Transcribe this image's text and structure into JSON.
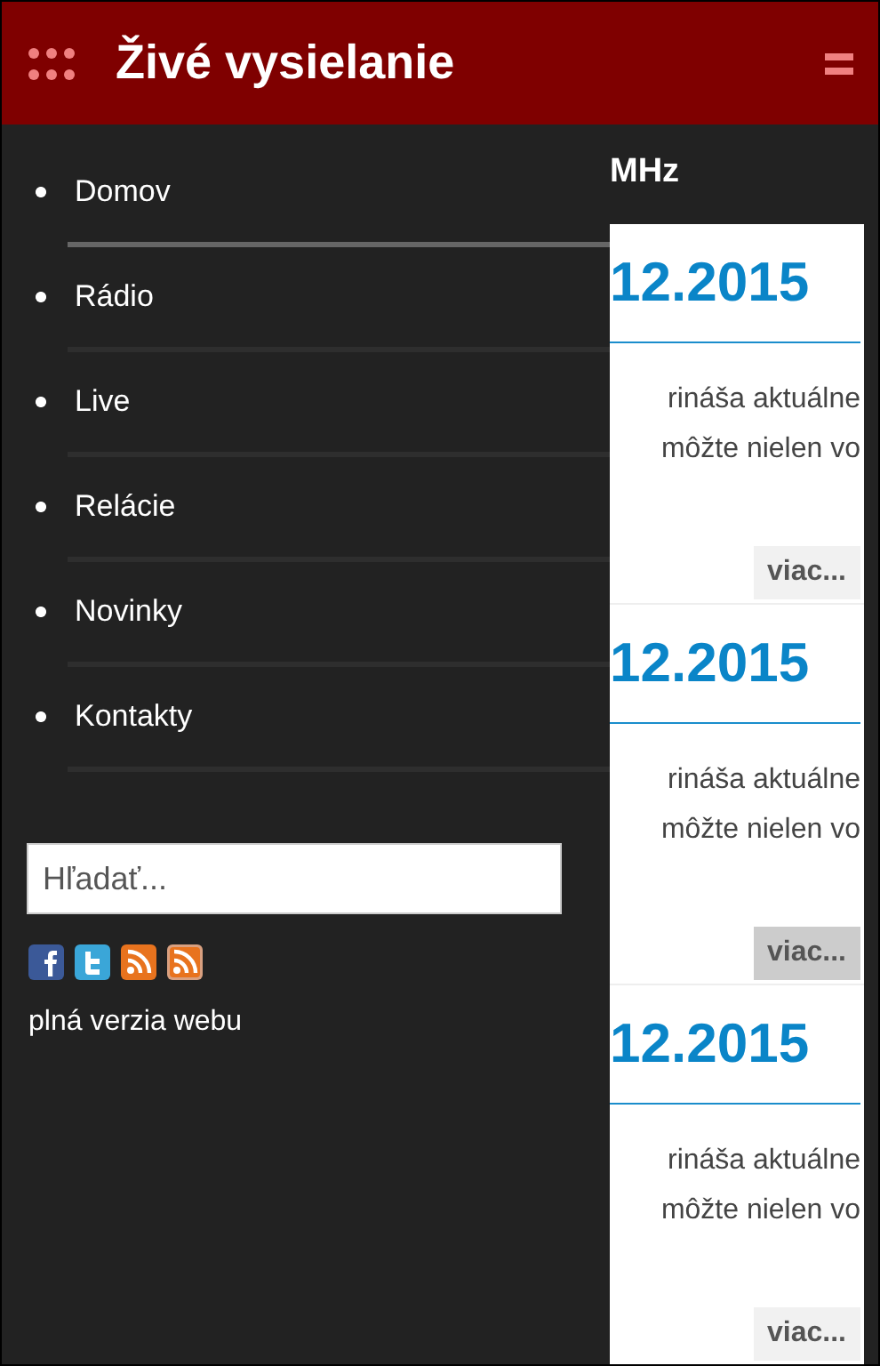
{
  "header": {
    "title": "Živé vysielanie"
  },
  "drawer": {
    "items": [
      {
        "label": "Domov",
        "selected": true
      },
      {
        "label": "Rádio",
        "selected": false
      },
      {
        "label": "Live",
        "selected": false
      },
      {
        "label": "Relácie",
        "selected": false
      },
      {
        "label": "Novinky",
        "selected": false
      },
      {
        "label": "Kontakty",
        "selected": false
      }
    ],
    "search": {
      "placeholder": "Hľadať..."
    },
    "full_site_link": "plná verzia webu"
  },
  "main": {
    "heading": "MHz",
    "articles": [
      {
        "date": "12.2015",
        "lines": [
          "rináša aktuálne",
          "môžte nielen vo"
        ],
        "more": "viac...",
        "hovered": false
      },
      {
        "date": "12.2015",
        "lines": [
          "rináša aktuálne",
          "môžte nielen vo"
        ],
        "more": "viac...",
        "hovered": true
      },
      {
        "date": "12.2015",
        "lines": [
          "rináša aktuálne",
          "môžte nielen vo"
        ],
        "more": "viac...",
        "hovered": false
      }
    ]
  }
}
